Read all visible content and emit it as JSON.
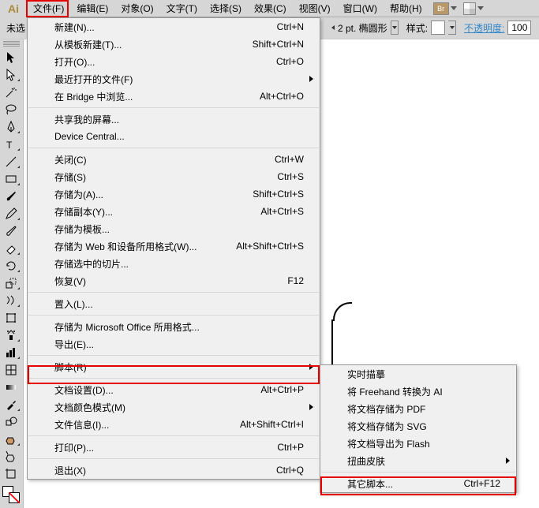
{
  "menubar": {
    "items": [
      "文件(F)",
      "编辑(E)",
      "对象(O)",
      "文字(T)",
      "选择(S)",
      "效果(C)",
      "视图(V)",
      "窗口(W)",
      "帮助(H)"
    ],
    "br": "Br"
  },
  "toolbar2": {
    "unsaved": "未选",
    "stroke_label": "2 pt. 椭圆形",
    "style_label": "样式:",
    "opacity_label": "不透明度:",
    "opacity_value": "100"
  },
  "file_menu": {
    "items": [
      {
        "label": "新建(N)...",
        "shortcut": "Ctrl+N"
      },
      {
        "label": "从模板新建(T)...",
        "shortcut": "Shift+Ctrl+N"
      },
      {
        "label": "打开(O)...",
        "shortcut": "Ctrl+O"
      },
      {
        "label": "最近打开的文件(F)",
        "submenu": true
      },
      {
        "label": "在 Bridge 中浏览...",
        "shortcut": "Alt+Ctrl+O"
      },
      {
        "sep": true
      },
      {
        "label": "共享我的屏幕..."
      },
      {
        "label": "Device Central..."
      },
      {
        "sep": true
      },
      {
        "label": "关闭(C)",
        "shortcut": "Ctrl+W"
      },
      {
        "label": "存储(S)",
        "shortcut": "Ctrl+S"
      },
      {
        "label": "存储为(A)...",
        "shortcut": "Shift+Ctrl+S"
      },
      {
        "label": "存储副本(Y)...",
        "shortcut": "Alt+Ctrl+S"
      },
      {
        "label": "存储为模板..."
      },
      {
        "label": "存储为 Web 和设备所用格式(W)...",
        "shortcut": "Alt+Shift+Ctrl+S"
      },
      {
        "label": "存储选中的切片..."
      },
      {
        "label": "恢复(V)",
        "shortcut": "F12"
      },
      {
        "sep": true
      },
      {
        "label": "置入(L)..."
      },
      {
        "sep": true
      },
      {
        "label": "存储为 Microsoft Office 所用格式..."
      },
      {
        "label": "导出(E)..."
      },
      {
        "sep": true
      },
      {
        "label": "脚本(R)",
        "submenu": true,
        "highlight": true
      },
      {
        "sep": true
      },
      {
        "label": "文档设置(D)...",
        "shortcut": "Alt+Ctrl+P"
      },
      {
        "label": "文档颜色模式(M)",
        "submenu": true
      },
      {
        "label": "文件信息(I)...",
        "shortcut": "Alt+Shift+Ctrl+I"
      },
      {
        "sep": true
      },
      {
        "label": "打印(P)...",
        "shortcut": "Ctrl+P"
      },
      {
        "sep": true
      },
      {
        "label": "退出(X)",
        "shortcut": "Ctrl+Q"
      }
    ]
  },
  "script_submenu": {
    "items": [
      {
        "label": "实时描摹"
      },
      {
        "label": "将 Freehand 转换为 AI"
      },
      {
        "label": "将文档存储为 PDF"
      },
      {
        "label": "将文档存储为 SVG"
      },
      {
        "label": "将文档导出为 Flash"
      },
      {
        "label": "扭曲皮肤",
        "submenu": true
      },
      {
        "sep": true
      },
      {
        "label": "其它脚本...",
        "shortcut": "Ctrl+F12",
        "highlight": true
      }
    ]
  }
}
